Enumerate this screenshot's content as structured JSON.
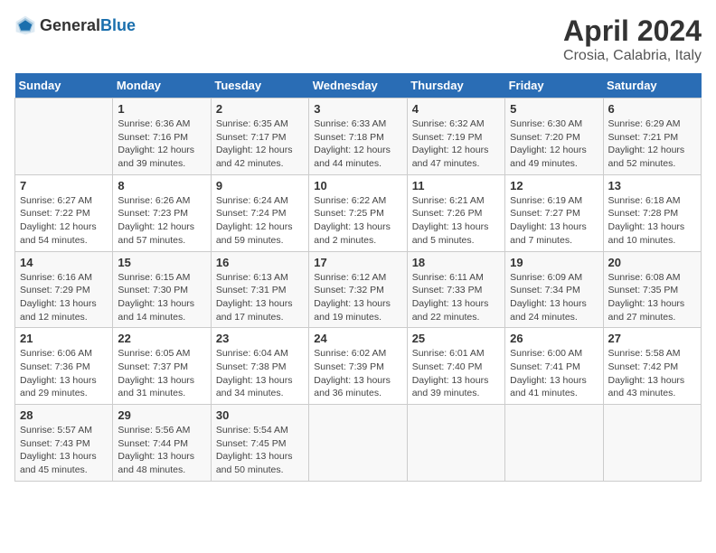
{
  "header": {
    "logo_general": "General",
    "logo_blue": "Blue",
    "title": "April 2024",
    "subtitle": "Crosia, Calabria, Italy"
  },
  "calendar": {
    "days_of_week": [
      "Sunday",
      "Monday",
      "Tuesday",
      "Wednesday",
      "Thursday",
      "Friday",
      "Saturday"
    ],
    "weeks": [
      [
        {
          "day": "",
          "info": ""
        },
        {
          "day": "1",
          "info": "Sunrise: 6:36 AM\nSunset: 7:16 PM\nDaylight: 12 hours\nand 39 minutes."
        },
        {
          "day": "2",
          "info": "Sunrise: 6:35 AM\nSunset: 7:17 PM\nDaylight: 12 hours\nand 42 minutes."
        },
        {
          "day": "3",
          "info": "Sunrise: 6:33 AM\nSunset: 7:18 PM\nDaylight: 12 hours\nand 44 minutes."
        },
        {
          "day": "4",
          "info": "Sunrise: 6:32 AM\nSunset: 7:19 PM\nDaylight: 12 hours\nand 47 minutes."
        },
        {
          "day": "5",
          "info": "Sunrise: 6:30 AM\nSunset: 7:20 PM\nDaylight: 12 hours\nand 49 minutes."
        },
        {
          "day": "6",
          "info": "Sunrise: 6:29 AM\nSunset: 7:21 PM\nDaylight: 12 hours\nand 52 minutes."
        }
      ],
      [
        {
          "day": "7",
          "info": "Sunrise: 6:27 AM\nSunset: 7:22 PM\nDaylight: 12 hours\nand 54 minutes."
        },
        {
          "day": "8",
          "info": "Sunrise: 6:26 AM\nSunset: 7:23 PM\nDaylight: 12 hours\nand 57 minutes."
        },
        {
          "day": "9",
          "info": "Sunrise: 6:24 AM\nSunset: 7:24 PM\nDaylight: 12 hours\nand 59 minutes."
        },
        {
          "day": "10",
          "info": "Sunrise: 6:22 AM\nSunset: 7:25 PM\nDaylight: 13 hours\nand 2 minutes."
        },
        {
          "day": "11",
          "info": "Sunrise: 6:21 AM\nSunset: 7:26 PM\nDaylight: 13 hours\nand 5 minutes."
        },
        {
          "day": "12",
          "info": "Sunrise: 6:19 AM\nSunset: 7:27 PM\nDaylight: 13 hours\nand 7 minutes."
        },
        {
          "day": "13",
          "info": "Sunrise: 6:18 AM\nSunset: 7:28 PM\nDaylight: 13 hours\nand 10 minutes."
        }
      ],
      [
        {
          "day": "14",
          "info": "Sunrise: 6:16 AM\nSunset: 7:29 PM\nDaylight: 13 hours\nand 12 minutes."
        },
        {
          "day": "15",
          "info": "Sunrise: 6:15 AM\nSunset: 7:30 PM\nDaylight: 13 hours\nand 14 minutes."
        },
        {
          "day": "16",
          "info": "Sunrise: 6:13 AM\nSunset: 7:31 PM\nDaylight: 13 hours\nand 17 minutes."
        },
        {
          "day": "17",
          "info": "Sunrise: 6:12 AM\nSunset: 7:32 PM\nDaylight: 13 hours\nand 19 minutes."
        },
        {
          "day": "18",
          "info": "Sunrise: 6:11 AM\nSunset: 7:33 PM\nDaylight: 13 hours\nand 22 minutes."
        },
        {
          "day": "19",
          "info": "Sunrise: 6:09 AM\nSunset: 7:34 PM\nDaylight: 13 hours\nand 24 minutes."
        },
        {
          "day": "20",
          "info": "Sunrise: 6:08 AM\nSunset: 7:35 PM\nDaylight: 13 hours\nand 27 minutes."
        }
      ],
      [
        {
          "day": "21",
          "info": "Sunrise: 6:06 AM\nSunset: 7:36 PM\nDaylight: 13 hours\nand 29 minutes."
        },
        {
          "day": "22",
          "info": "Sunrise: 6:05 AM\nSunset: 7:37 PM\nDaylight: 13 hours\nand 31 minutes."
        },
        {
          "day": "23",
          "info": "Sunrise: 6:04 AM\nSunset: 7:38 PM\nDaylight: 13 hours\nand 34 minutes."
        },
        {
          "day": "24",
          "info": "Sunrise: 6:02 AM\nSunset: 7:39 PM\nDaylight: 13 hours\nand 36 minutes."
        },
        {
          "day": "25",
          "info": "Sunrise: 6:01 AM\nSunset: 7:40 PM\nDaylight: 13 hours\nand 39 minutes."
        },
        {
          "day": "26",
          "info": "Sunrise: 6:00 AM\nSunset: 7:41 PM\nDaylight: 13 hours\nand 41 minutes."
        },
        {
          "day": "27",
          "info": "Sunrise: 5:58 AM\nSunset: 7:42 PM\nDaylight: 13 hours\nand 43 minutes."
        }
      ],
      [
        {
          "day": "28",
          "info": "Sunrise: 5:57 AM\nSunset: 7:43 PM\nDaylight: 13 hours\nand 45 minutes."
        },
        {
          "day": "29",
          "info": "Sunrise: 5:56 AM\nSunset: 7:44 PM\nDaylight: 13 hours\nand 48 minutes."
        },
        {
          "day": "30",
          "info": "Sunrise: 5:54 AM\nSunset: 7:45 PM\nDaylight: 13 hours\nand 50 minutes."
        },
        {
          "day": "",
          "info": ""
        },
        {
          "day": "",
          "info": ""
        },
        {
          "day": "",
          "info": ""
        },
        {
          "day": "",
          "info": ""
        }
      ]
    ]
  }
}
